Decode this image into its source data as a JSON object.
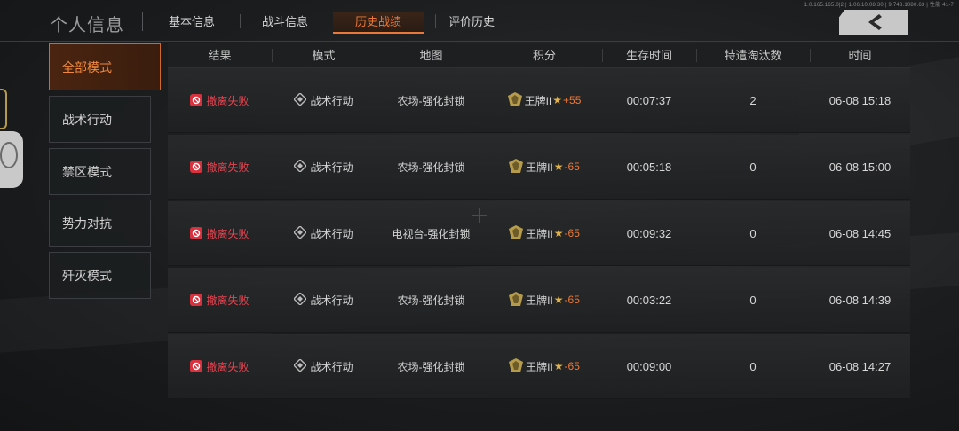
{
  "watermark": "1.0.165.165.0|2 | 1.06.10.08.30 | 9.743.1080.63 | 性能 41-7",
  "header": {
    "title": "个人信息",
    "tabs": [
      {
        "label": "基本信息",
        "active": false
      },
      {
        "label": "战斗信息",
        "active": false
      },
      {
        "label": "历史战绩",
        "active": true
      },
      {
        "label": "评价历史",
        "active": false
      }
    ],
    "back_icon": "chevron-left-icon"
  },
  "modes": [
    {
      "label": "全部模式",
      "active": true
    },
    {
      "label": "战术行动",
      "active": false
    },
    {
      "label": "禁区模式",
      "active": false
    },
    {
      "label": "势力对抗",
      "active": false
    },
    {
      "label": "歼灭模式",
      "active": false
    }
  ],
  "table": {
    "columns": [
      "结果",
      "模式",
      "地图",
      "积分",
      "生存时间",
      "特遣淘汰数",
      "时间"
    ],
    "rows": [
      {
        "result": "撤离失败",
        "mode": "战术行动",
        "map": "农场-强化封锁",
        "rank": "王牌II",
        "score_change": "+55",
        "survival": "00:07:37",
        "eliminations": "2",
        "time": "06-08 15:18"
      },
      {
        "result": "撤离失败",
        "mode": "战术行动",
        "map": "农场-强化封锁",
        "rank": "王牌II",
        "score_change": "-65",
        "survival": "00:05:18",
        "eliminations": "0",
        "time": "06-08 15:00"
      },
      {
        "result": "撤离失败",
        "mode": "战术行动",
        "map": "电视台-强化封锁",
        "rank": "王牌II",
        "score_change": "-65",
        "survival": "00:09:32",
        "eliminations": "0",
        "time": "06-08 14:45"
      },
      {
        "result": "撤离失败",
        "mode": "战术行动",
        "map": "农场-强化封锁",
        "rank": "王牌II",
        "score_change": "-65",
        "survival": "00:03:22",
        "eliminations": "0",
        "time": "06-08 14:39"
      },
      {
        "result": "撤离失败",
        "mode": "战术行动",
        "map": "农场-强化封锁",
        "rank": "王牌II",
        "score_change": "-65",
        "survival": "00:09:00",
        "eliminations": "0",
        "time": "06-08 14:27"
      }
    ]
  },
  "colors": {
    "accent": "#e9793a",
    "fail_red": "#e8434f",
    "star_gold": "#e2b24a"
  }
}
